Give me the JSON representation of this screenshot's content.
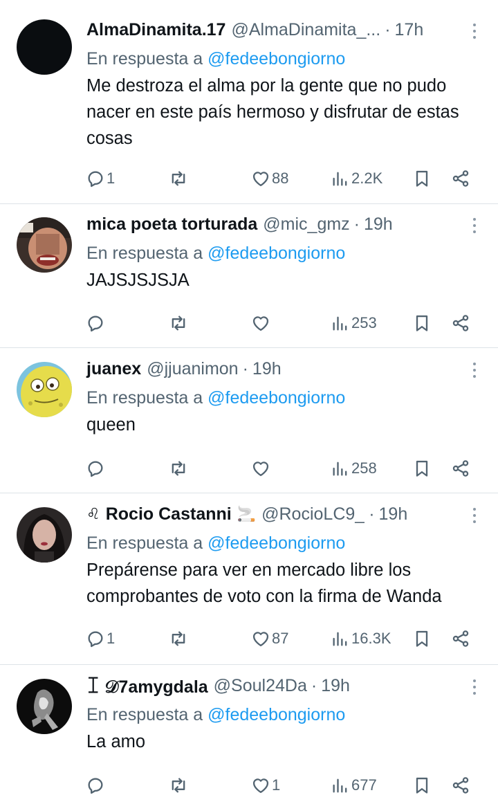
{
  "reply_prefix": "En respuesta a",
  "colors": {
    "link": "#1d9bf0",
    "secondary": "#536471",
    "divider": "#dde3e7"
  },
  "tweets": [
    {
      "name": "AlmaDinamita.17",
      "handle": "@AlmaDinamita_...",
      "time": "17h",
      "mention": "@fedeebongiorno",
      "text": "Me destroza el alma por la gente que no pudo nacer en este país hermoso y disfrutar de estas cosas",
      "replies": "1",
      "retweets": "",
      "likes": "88",
      "views": "2.2K"
    },
    {
      "name": "mica poeta torturada",
      "handle": "@mic_gmz",
      "time": "19h",
      "mention": "@fedeebongiorno",
      "text": "JAJSJSJSJA",
      "replies": "",
      "retweets": "",
      "likes": "",
      "views": "253"
    },
    {
      "name": "juanex",
      "handle": "@jjuanimon",
      "time": "19h",
      "mention": "@fedeebongiorno",
      "text": "queen",
      "replies": "",
      "retweets": "",
      "likes": "",
      "views": "258"
    },
    {
      "name_prefix_icon": "leo-sign-emoji",
      "name_prefix": "♌",
      "name": "Rocio Castanni",
      "name_suffix_icon": "cigarette-emoji",
      "name_suffix": "🚬",
      "handle": "@RocioLC9_",
      "time": "19h",
      "mention": "@fedeebongiorno",
      "text": "Prepárense para ver en mercado libre los comprobantes de voto con la firma de Wanda",
      "replies": "1",
      "retweets": "",
      "likes": "87",
      "views": "16.3K"
    },
    {
      "name": "ꀤ 𝒟7amygdala",
      "handle": "@Soul24Da",
      "time": "19h",
      "mention": "@fedeebongiorno",
      "text": "La amo",
      "replies": "",
      "retweets": "",
      "likes": "1",
      "views": "677"
    }
  ]
}
